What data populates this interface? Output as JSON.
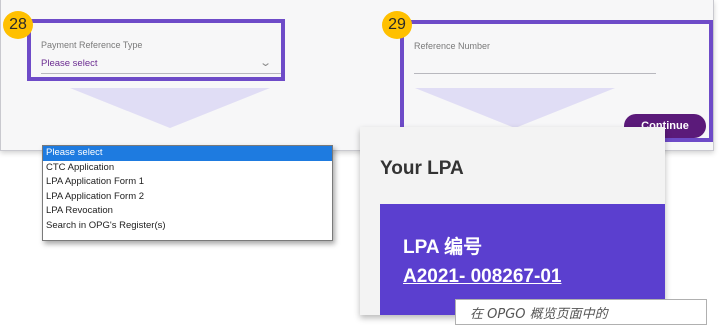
{
  "form": {
    "payment_ref_type": {
      "label": "Payment Reference Type",
      "value": "Please select"
    },
    "reference_number": {
      "label": "Reference Number",
      "value": ""
    },
    "continue_label": "Continue"
  },
  "markers": {
    "m28": "28",
    "m29": "29"
  },
  "dropdown_options": [
    "Please select",
    "CTC Application",
    "LPA Application Form 1",
    "LPA Application Form 2",
    "LPA Revocation",
    "Search in OPG's Register(s)"
  ],
  "lpa_card": {
    "heading": "Your LPA",
    "number_label": "LPA 编号",
    "number_value": "A2021- 008267-01"
  },
  "caption": "在 OPGO 概览页面中的",
  "colors": {
    "highlight": "#6e4bc8",
    "marker": "#ffc000",
    "brand_purple": "#5b1a7a",
    "card_purple": "#5b3fcf",
    "selected_option": "#1e7be0",
    "select_text": "#6b2c91"
  }
}
